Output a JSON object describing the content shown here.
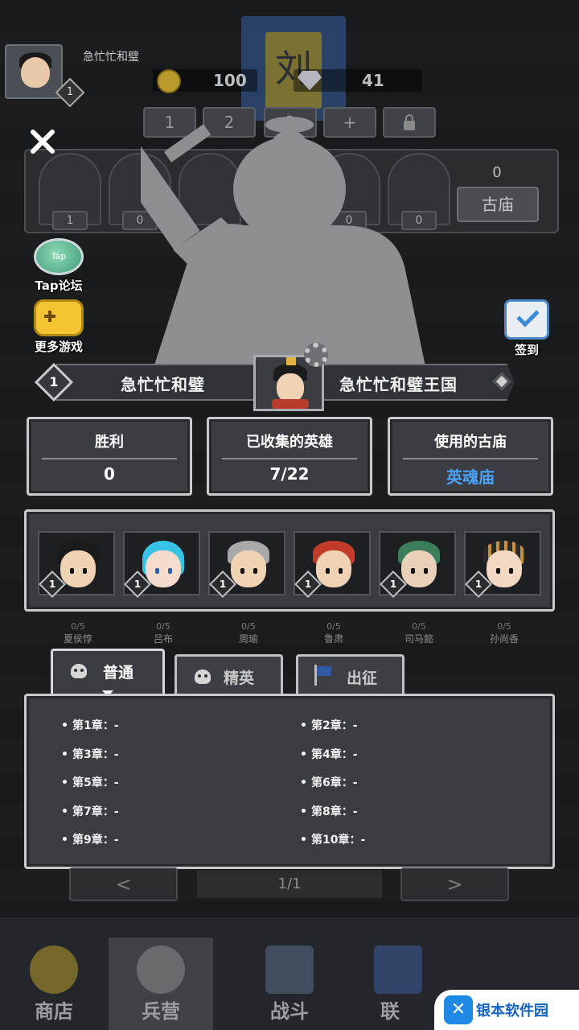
{
  "top_hud": {
    "player_name": "急忙忙和璧",
    "player_level": "1",
    "gold": "100",
    "gems": "41",
    "banner_glyph": "刘",
    "slots": [
      "1",
      "2",
      "3",
      "+"
    ],
    "temple_label": "古庙",
    "temple_count": "0",
    "arch_counts": [
      "1",
      "0",
      "",
      "0",
      "0"
    ]
  },
  "side": {
    "tap_label": "Tap论坛",
    "tap_icon_text": "Tap",
    "more_games_label": "更多游戏",
    "checkin_label": "签到"
  },
  "profile": {
    "level": "1",
    "name": "急忙忙和璧",
    "kingdom": "急忙忙和璧王国"
  },
  "stats": [
    {
      "title": "胜利",
      "value": "0"
    },
    {
      "title": "已收集的英雄",
      "value": "7/22"
    },
    {
      "title": "使用的古庙",
      "value": "英魂庙"
    }
  ],
  "heroes": [
    {
      "level": "1",
      "hair": "#1b1b1b",
      "skin": "#f0d2b5"
    },
    {
      "level": "1",
      "hair": "#38c2e6",
      "skin": "#f6dccc"
    },
    {
      "level": "1",
      "hair": "#a9a9a9",
      "skin": "#f0d2b5"
    },
    {
      "level": "1",
      "hair": "#c23b2b",
      "skin": "#f0d2b5"
    },
    {
      "level": "1",
      "hair": "#3c7d5a",
      "skin": "#e9d0b8"
    },
    {
      "level": "1",
      "hair": "#2a2a2a",
      "skin": "#f3d9c4"
    }
  ],
  "dim_heroes": [
    {
      "count": "0/5",
      "name": "夏侯惇"
    },
    {
      "count": "0/5",
      "name": "吕布"
    },
    {
      "count": "0/5",
      "name": "周瑜"
    },
    {
      "count": "0/5",
      "name": "鲁肃"
    },
    {
      "count": "0/5",
      "name": "司马懿"
    },
    {
      "count": "0/5",
      "name": "孙尚香"
    }
  ],
  "tabs": [
    {
      "label": "普通",
      "active": true
    },
    {
      "label": "精英",
      "active": false
    },
    {
      "label": "出征",
      "active": false
    }
  ],
  "chapters": [
    "第1章：-",
    "第2章：-",
    "第3章：-",
    "第4章：-",
    "第5章：-",
    "第6章：-",
    "第7章：-",
    "第8章：-",
    "第9章：-",
    "第10章：-"
  ],
  "pager": {
    "prev": "<",
    "next": ">",
    "page": "1/1"
  },
  "bottom_nav": [
    "商店",
    "兵营",
    "战斗",
    "联"
  ],
  "watermark": {
    "logo": "✕",
    "text": "银本软件园"
  },
  "colors": {
    "accent_blue": "#4aa3ff",
    "panel": "#393c40",
    "border": "#c8cacc"
  }
}
